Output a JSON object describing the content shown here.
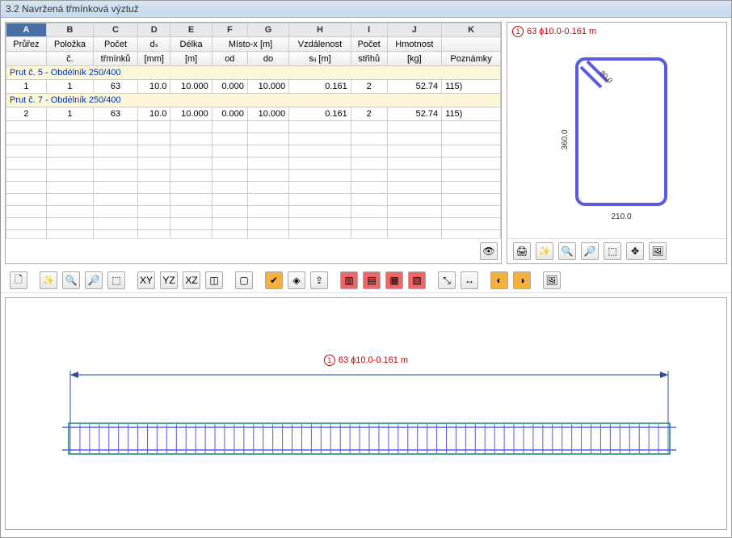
{
  "title": "3.2 Navržená třmínková výztuž",
  "columns": {
    "letters": [
      "A",
      "B",
      "C",
      "D",
      "E",
      "F",
      "G",
      "H",
      "I",
      "J",
      "K"
    ],
    "h1": [
      "Průřez",
      "Položka",
      "Počet",
      "dₛ",
      "Délka",
      "Místo-x [m]",
      "",
      "Vzdálenost",
      "Počet",
      "Hmotnost",
      ""
    ],
    "h2": [
      "",
      "č.",
      "třmínků",
      "[mm]",
      "[m]",
      "od",
      "do",
      "sₗᵢ [m]",
      "střihů",
      "[kg]",
      "Poznámky"
    ],
    "span_misto": 2
  },
  "groups": [
    {
      "title": "Prut č. 5 - Obdélník 250/400",
      "rows": [
        {
          "a": "1",
          "b": "1",
          "c": "63",
          "d": "10.0",
          "e": "10.000",
          "f": "0.000",
          "g": "10.000",
          "h": "0.161",
          "i": "2",
          "j": "52.74",
          "k": "115)"
        }
      ]
    },
    {
      "title": "Prut č. 7 - Obdélník 250/400",
      "rows": [
        {
          "a": "2",
          "b": "1",
          "c": "63",
          "d": "10.0",
          "e": "10.000",
          "f": "0.000",
          "g": "10.000",
          "h": "0.161",
          "i": "2",
          "j": "52.74",
          "k": "115)"
        }
      ]
    }
  ],
  "section": {
    "label": "63 ɸ10.0-0.161 m",
    "num": "1",
    "width": "210.0",
    "height": "360.0",
    "hook": "80.0"
  },
  "beam": {
    "label": "63 ɸ10.0-0.161 m",
    "num": "1"
  },
  "icons": {
    "eye": "👁",
    "print": "🖨",
    "search": "🔍",
    "zoomout": "🔎",
    "select": "⬚",
    "arrows": "✥",
    "pic": "🖼",
    "new": "🗋",
    "wand": "✨",
    "find": "🔍",
    "zoom": "🔎",
    "region": "⬚",
    "xy": "XY",
    "yz": "YZ",
    "xz": "XZ",
    "cube": "◫",
    "box": "▢",
    "check": "✔",
    "layer": "◈",
    "export": "⇪",
    "c1": "▥",
    "c2": "▤",
    "c3": "▦",
    "c4": "▧",
    "axis": "⤡",
    "dim": "↔",
    "s1": "◐",
    "s2": "◑",
    "img": "🖼"
  }
}
